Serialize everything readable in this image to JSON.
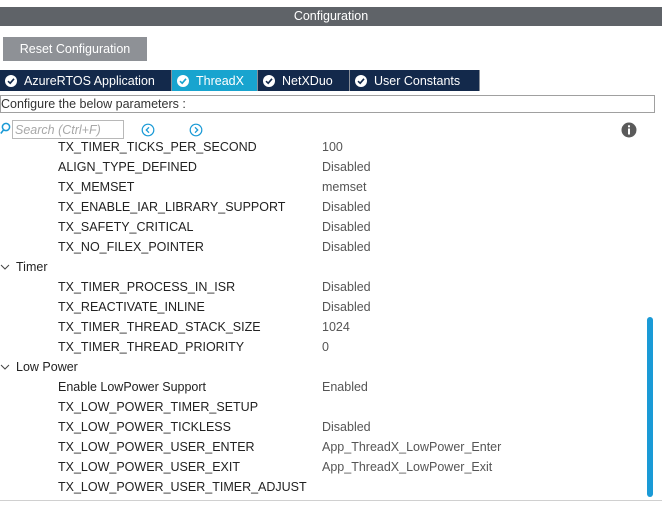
{
  "header": {
    "title": "Configuration"
  },
  "toolbar": {
    "reset_label": "Reset Configuration"
  },
  "tabs": [
    {
      "label": "AzureRTOS Application",
      "active": false
    },
    {
      "label": "ThreadX",
      "active": true
    },
    {
      "label": "NetXDuo",
      "active": false
    },
    {
      "label": "User Constants",
      "active": false
    }
  ],
  "subheader": {
    "text": "Configure the below parameters :"
  },
  "search": {
    "placeholder": "Search (Ctrl+F)"
  },
  "params": {
    "partial": {
      "name": "TX_TIMER_TICKS_PER_SECOND",
      "value": "100"
    },
    "p1": {
      "name": "ALIGN_TYPE_DEFINED",
      "value": "Disabled"
    },
    "p2": {
      "name": "TX_MEMSET",
      "value": "memset"
    },
    "p3": {
      "name": "TX_ENABLE_IAR_LIBRARY_SUPPORT",
      "value": "Disabled"
    },
    "p4": {
      "name": "TX_SAFETY_CRITICAL",
      "value": "Disabled"
    },
    "p5": {
      "name": "TX_NO_FILEX_POINTER",
      "value": "Disabled"
    },
    "timer_group": "Timer",
    "t1": {
      "name": "TX_TIMER_PROCESS_IN_ISR",
      "value": "Disabled"
    },
    "t2": {
      "name": "TX_REACTIVATE_INLINE",
      "value": "Disabled"
    },
    "t3": {
      "name": "TX_TIMER_THREAD_STACK_SIZE",
      "value": "1024"
    },
    "t4": {
      "name": "TX_TIMER_THREAD_PRIORITY",
      "value": "0"
    },
    "lp_group": "Low Power",
    "l1": {
      "name": "Enable LowPower Support",
      "value": "Enabled"
    },
    "l2": {
      "name": "TX_LOW_POWER_TIMER_SETUP",
      "value": ""
    },
    "l3": {
      "name": "TX_LOW_POWER_TICKLESS",
      "value": "Disabled"
    },
    "l4": {
      "name": "TX_LOW_POWER_USER_ENTER",
      "value": "App_ThreadX_LowPower_Enter"
    },
    "l5": {
      "name": "TX_LOW_POWER_USER_EXIT",
      "value": "App_ThreadX_LowPower_Exit"
    },
    "l6": {
      "name": "TX_LOW_POWER_USER_TIMER_ADJUST",
      "value": ""
    }
  },
  "colors": {
    "header_bg": "#5f6368",
    "tab_bg": "#13294b",
    "tab_active_bg": "#18a4cf",
    "accent": "#1a9ad6"
  }
}
